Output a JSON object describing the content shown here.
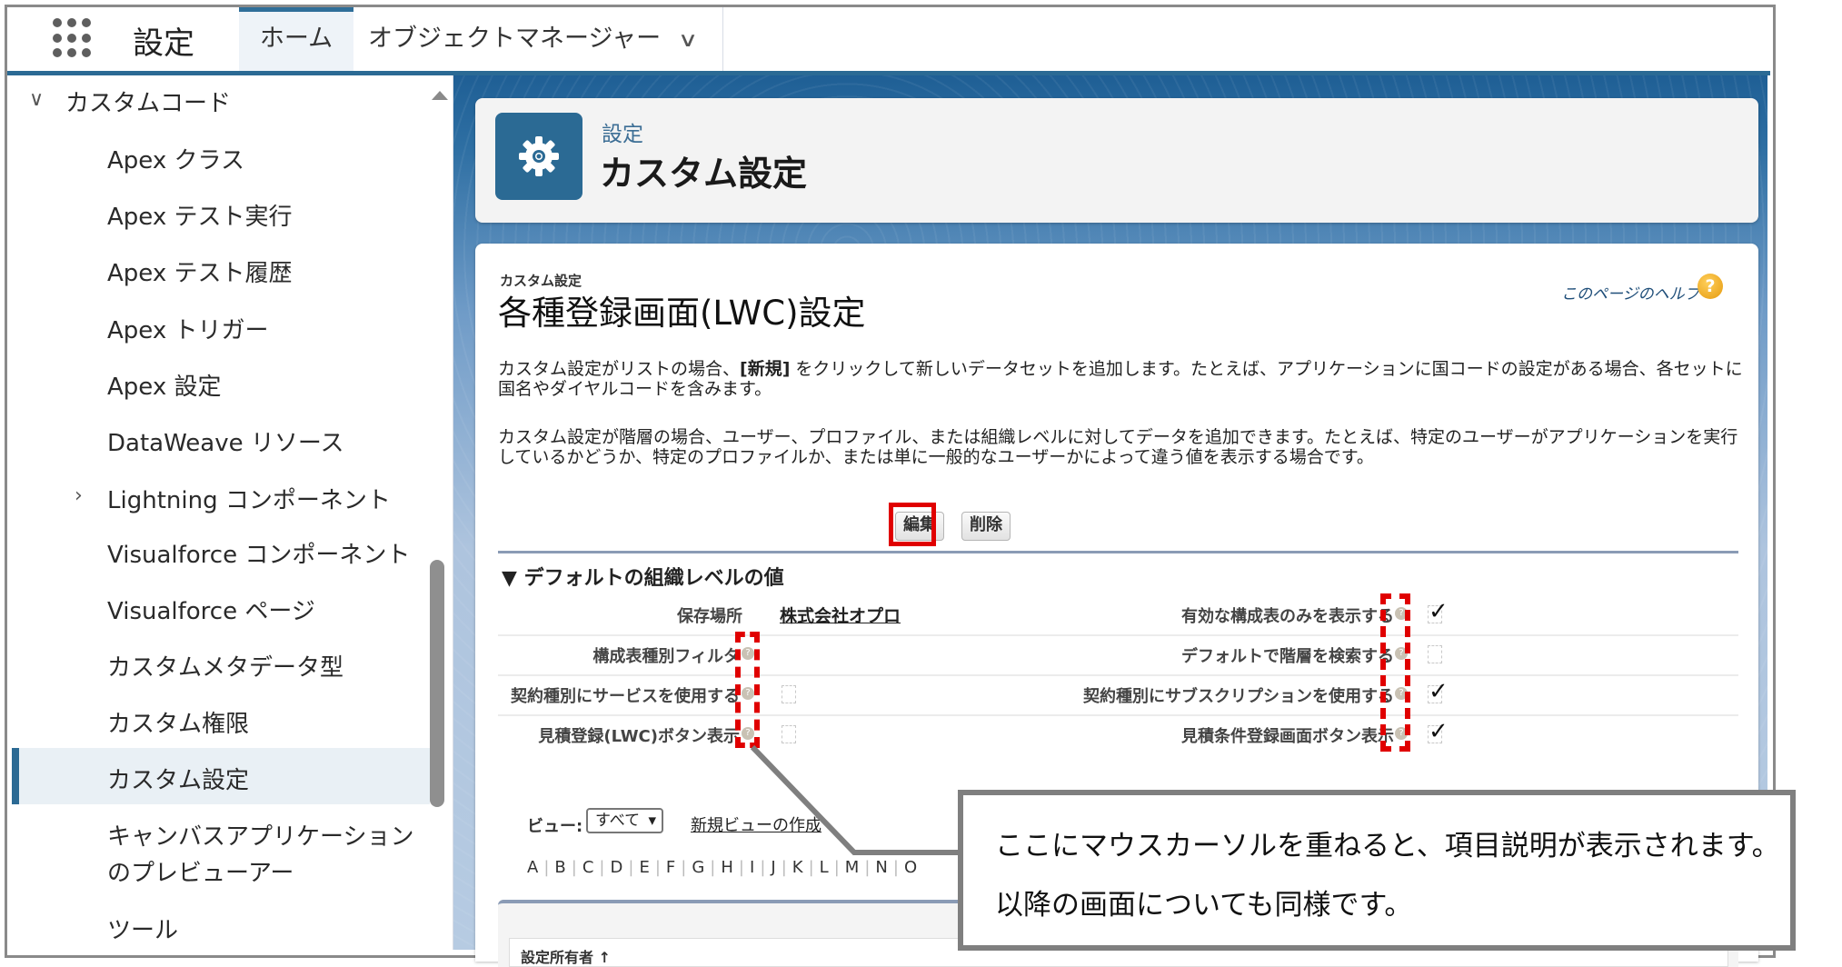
{
  "topnav": {
    "app_launcher_icon": "app-launcher-grid-icon",
    "app_title": "設定",
    "tabs": [
      {
        "label": "ホーム",
        "active": true
      },
      {
        "label": "オブジェクトマネージャー",
        "has_dropdown": true
      }
    ],
    "dropdown_glyph": "∨"
  },
  "sidebar": {
    "group": {
      "label": "カスタムコード",
      "expanded": true,
      "caret": "∨"
    },
    "items": [
      {
        "label": "Apex クラス"
      },
      {
        "label": "Apex テスト実行"
      },
      {
        "label": "Apex テスト履歴"
      },
      {
        "label": "Apex トリガー"
      },
      {
        "label": "Apex 設定"
      },
      {
        "label": "DataWeave リソース"
      },
      {
        "label": "Lightning コンポーネント",
        "caret": "›"
      },
      {
        "label": "Visualforce コンポーネント"
      },
      {
        "label": "Visualforce ページ"
      },
      {
        "label": "カスタムメタデータ型"
      },
      {
        "label": "カスタム権限"
      },
      {
        "label": "カスタム設定",
        "selected": true
      },
      {
        "label_line1": "キャンバスアプリケーション",
        "label_line2": "のプレビューアー"
      },
      {
        "label": "ツール"
      }
    ],
    "accent_color": "#2b6a94"
  },
  "header": {
    "icon": "gear-icon",
    "eyebrow": "設定",
    "title": "カスタム設定",
    "icon_bg": "#2b6a94"
  },
  "page": {
    "eyebrow": "カスタム設定",
    "title": "各種登録画面(LWC)設定",
    "help_link": "このページのヘルプ",
    "help_icon": "?",
    "desc1_pre": "カスタム設定がリストの場合、",
    "desc1_bold": "[新規]",
    "desc1_post": " をクリックして新しいデータセットを追加します。たとえば、アプリケーションに国コードの設定がある場合、各セットに国名やダイヤルコードを含みます。",
    "desc2": "カスタム設定が階層の場合、ユーザー、プロファイル、または組織レベルに対してデータを追加できます。たとえば、特定のユーザーがアプリケーションを実行しているかどうか、特定のプロファイルか、または単に一般的なユーザーかによって違う値を表示する場合です。",
    "buttons": {
      "edit": "編集",
      "delete": "削除"
    },
    "section_title": "▼ デフォルトの組織レベルの値",
    "fields_left": [
      {
        "label": "保存場所",
        "value": "株式会社オプロ",
        "is_link": true
      },
      {
        "label": "構成表種別フィルタ",
        "value": "",
        "help": true
      },
      {
        "label": "契約種別にサービスを使用する",
        "checked": false,
        "help": true
      },
      {
        "label": "見積登録(LWC)ボタン表示",
        "checked": false,
        "help": true
      }
    ],
    "fields_right": [
      {
        "label": "有効な構成表のみを表示する",
        "checked": true,
        "help": true
      },
      {
        "label": "デフォルトで階層を検索する",
        "checked": false,
        "help": true
      },
      {
        "label": "契約種別にサブスクリプションを使用する",
        "checked": true,
        "help": true
      },
      {
        "label": "見積条件登録画面ボタン表示",
        "checked": true,
        "help": true
      }
    ],
    "help_glyph": "?",
    "check_glyph": "✓",
    "view_label": "ビュー:",
    "view_selected": "すべて",
    "view_caret": "▾",
    "new_view_link": "新規ビューの作成",
    "alphabet": [
      "A",
      "B",
      "C",
      "D",
      "E",
      "F",
      "G",
      "H",
      "I",
      "J",
      "K",
      "L",
      "M",
      "N",
      "O"
    ],
    "list_header_partial": "設定所有者 ↑"
  },
  "annotation": {
    "line1": "ここにマウスカーソルを重ねると、項目説明が表示されます。",
    "line2": "以降の画面についても同様です。",
    "highlight_color": "#e00000",
    "callout_border": "#7f7f7f"
  }
}
